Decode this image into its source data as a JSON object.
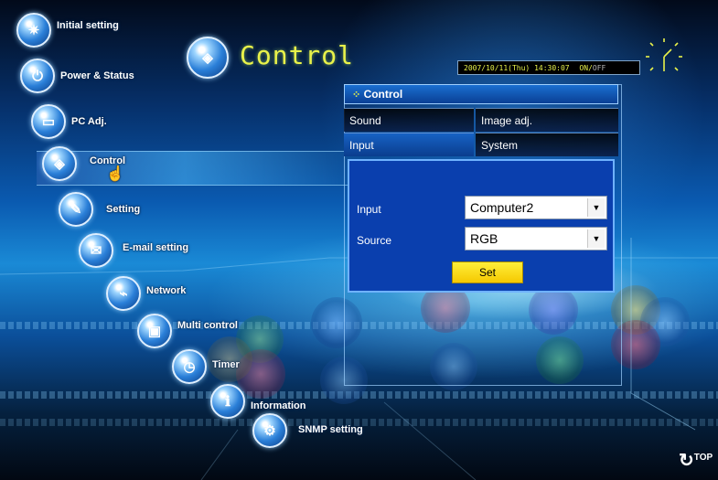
{
  "page": {
    "title": "Control"
  },
  "status_bar": {
    "datetime": "2007/10/11(Thu) 14:30:07",
    "power_on": "ON",
    "separator": "/",
    "power_off": "OFF"
  },
  "nav": {
    "items": [
      {
        "label": "Initial setting",
        "icon": "initial-setting-icon"
      },
      {
        "label": "Power & Status",
        "icon": "power-status-icon"
      },
      {
        "label": "PC Adj.",
        "icon": "pc-adj-icon"
      },
      {
        "label": "Control",
        "icon": "control-icon"
      },
      {
        "label": "Setting",
        "icon": "setting-icon"
      },
      {
        "label": "E-mail setting",
        "icon": "email-icon"
      },
      {
        "label": "Network",
        "icon": "network-icon"
      },
      {
        "label": "Multi control",
        "icon": "multi-control-icon"
      },
      {
        "label": "Timer",
        "icon": "timer-icon"
      },
      {
        "label": "Information",
        "icon": "information-icon"
      },
      {
        "label": "SNMP setting",
        "icon": "snmp-icon"
      }
    ]
  },
  "panel": {
    "header": "Control",
    "tabs": [
      {
        "label": "Sound"
      },
      {
        "label": "Image adj."
      },
      {
        "label": "Input"
      },
      {
        "label": "System"
      }
    ],
    "form": {
      "input_label": "Input",
      "input_value": "Computer2",
      "source_label": "Source",
      "source_value": "RGB",
      "set_label": "Set"
    }
  },
  "footer": {
    "top_label": "TOP"
  },
  "colors": {
    "accent_yellow": "#e9f24a",
    "panel_blue": "#0a3fae",
    "set_button": "#f5c800"
  }
}
